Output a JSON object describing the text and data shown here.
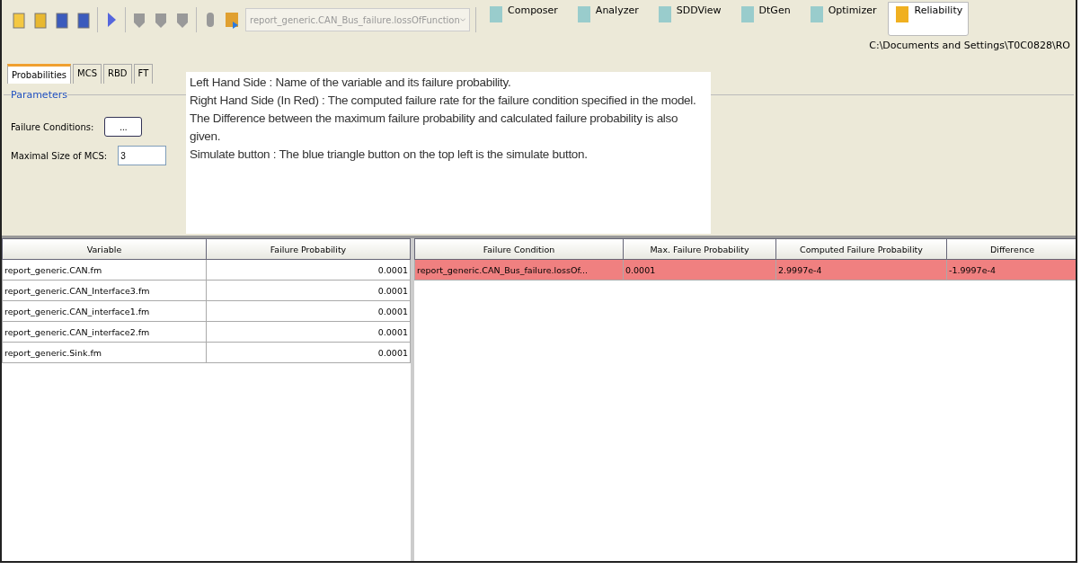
{
  "toolbar": {
    "combo": "report_generic.CAN_Bus_failure.lossOfFunction",
    "modules": [
      {
        "label": "Composer",
        "selected": false
      },
      {
        "label": "Analyzer",
        "selected": false
      },
      {
        "label": "SDDView",
        "selected": false
      },
      {
        "label": "DtGen",
        "selected": false
      },
      {
        "label": "Optimizer",
        "selected": false
      },
      {
        "label": "Reliability",
        "selected": true
      }
    ],
    "path": "C:\\Documents and Settings\\T0C0828\\RO"
  },
  "tabs": [
    {
      "label": "Probabilities",
      "selected": true
    },
    {
      "label": "MCS",
      "selected": false
    },
    {
      "label": "RBD",
      "selected": false
    },
    {
      "label": "FT",
      "selected": false
    }
  ],
  "parameters": {
    "title": "Parameters",
    "failure_conditions_label": "Failure Conditions:",
    "failure_conditions_button": "...",
    "mcs_label": "Maximal Size of MCS:",
    "mcs_value": "3"
  },
  "note": [
    "Left Hand Side : Name of the variable and its failure probability.",
    "Right Hand Side (In Red) : The computed failure rate for the failure condition specified in the model. The Difference between the maximum failure probability and calculated failure probability is also given.",
    "Simulate button : The blue triangle button on the top left is the simulate button."
  ],
  "variables": {
    "columns": [
      "Variable",
      "Failure Probability"
    ],
    "rows": [
      [
        "report_generic.CAN.fm",
        "0.0001"
      ],
      [
        "report_generic.CAN_Interface3.fm",
        "0.0001"
      ],
      [
        "report_generic.CAN_interface1.fm",
        "0.0001"
      ],
      [
        "report_generic.CAN_interface2.fm",
        "0.0001"
      ],
      [
        "report_generic.Sink.fm",
        "0.0001"
      ]
    ]
  },
  "conditions": {
    "columns": [
      "Failure Condition",
      "Max. Failure Probability",
      "Computed Failure Probability",
      "Difference"
    ],
    "rows": [
      {
        "cells": [
          "report_generic.CAN_Bus_failure.lossOf...",
          "0.0001",
          "2.9997e-4",
          "-1.9997e-4"
        ],
        "failed": true
      }
    ]
  }
}
